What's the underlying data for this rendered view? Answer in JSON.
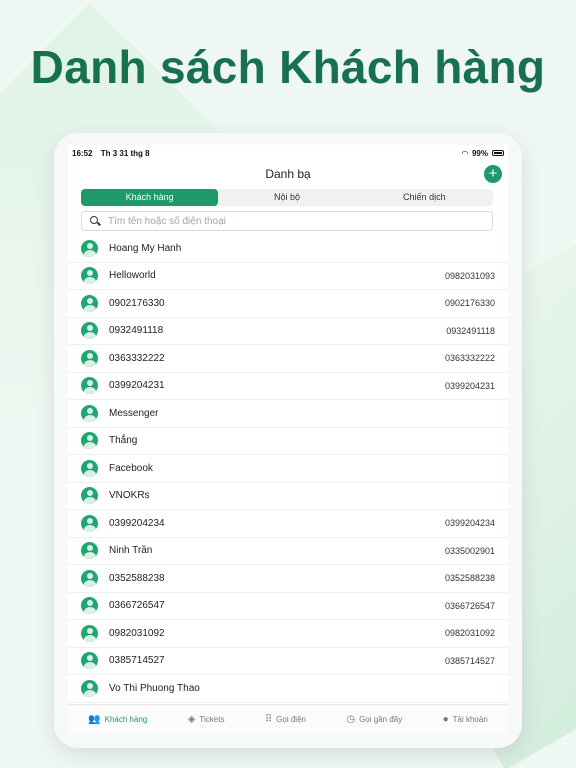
{
  "headline": "Danh sách Khách hàng",
  "status": {
    "time": "16:52",
    "date": "Th 3 31 thg 8",
    "battery": "99%"
  },
  "nav": {
    "title": "Danh bạ"
  },
  "segments": [
    "Khách hàng",
    "Nội bộ",
    "Chiến dịch"
  ],
  "search": {
    "placeholder": "Tìm tên hoặc số điện thoại",
    "value": ""
  },
  "contacts": [
    {
      "name": "Hoang My Hanh",
      "phone": ""
    },
    {
      "name": "Helloworld",
      "phone": "0982031093"
    },
    {
      "name": "0902176330",
      "phone": "0902176330"
    },
    {
      "name": "0932491118",
      "phone": "0932491118"
    },
    {
      "name": "0363332222",
      "phone": "0363332222"
    },
    {
      "name": "0399204231",
      "phone": "0399204231"
    },
    {
      "name": "Messenger",
      "phone": ""
    },
    {
      "name": "Thắng",
      "phone": ""
    },
    {
      "name": "Facebook",
      "phone": ""
    },
    {
      "name": "VNOKRs",
      "phone": ""
    },
    {
      "name": "0399204234",
      "phone": "0399204234"
    },
    {
      "name": "Ninh Trần",
      "phone": "0335002901"
    },
    {
      "name": "0352588238",
      "phone": "0352588238"
    },
    {
      "name": "0366726547",
      "phone": "0366726547"
    },
    {
      "name": "0982031092",
      "phone": "0982031092"
    },
    {
      "name": "0385714527",
      "phone": "0385714527"
    },
    {
      "name": "Vo Thi Phuong Thao",
      "phone": ""
    }
  ],
  "tabs": [
    {
      "label": "Khách hàng",
      "icon": "users-icon"
    },
    {
      "label": "Tickets",
      "icon": "ticket-icon"
    },
    {
      "label": "Gọi điện",
      "icon": "keypad-icon"
    },
    {
      "label": "Gọi gần đây",
      "icon": "clock-icon"
    },
    {
      "label": "Tài khoản",
      "icon": "person-icon"
    }
  ],
  "colors": {
    "accent": "#1e9a6a",
    "headline": "#17704f"
  }
}
